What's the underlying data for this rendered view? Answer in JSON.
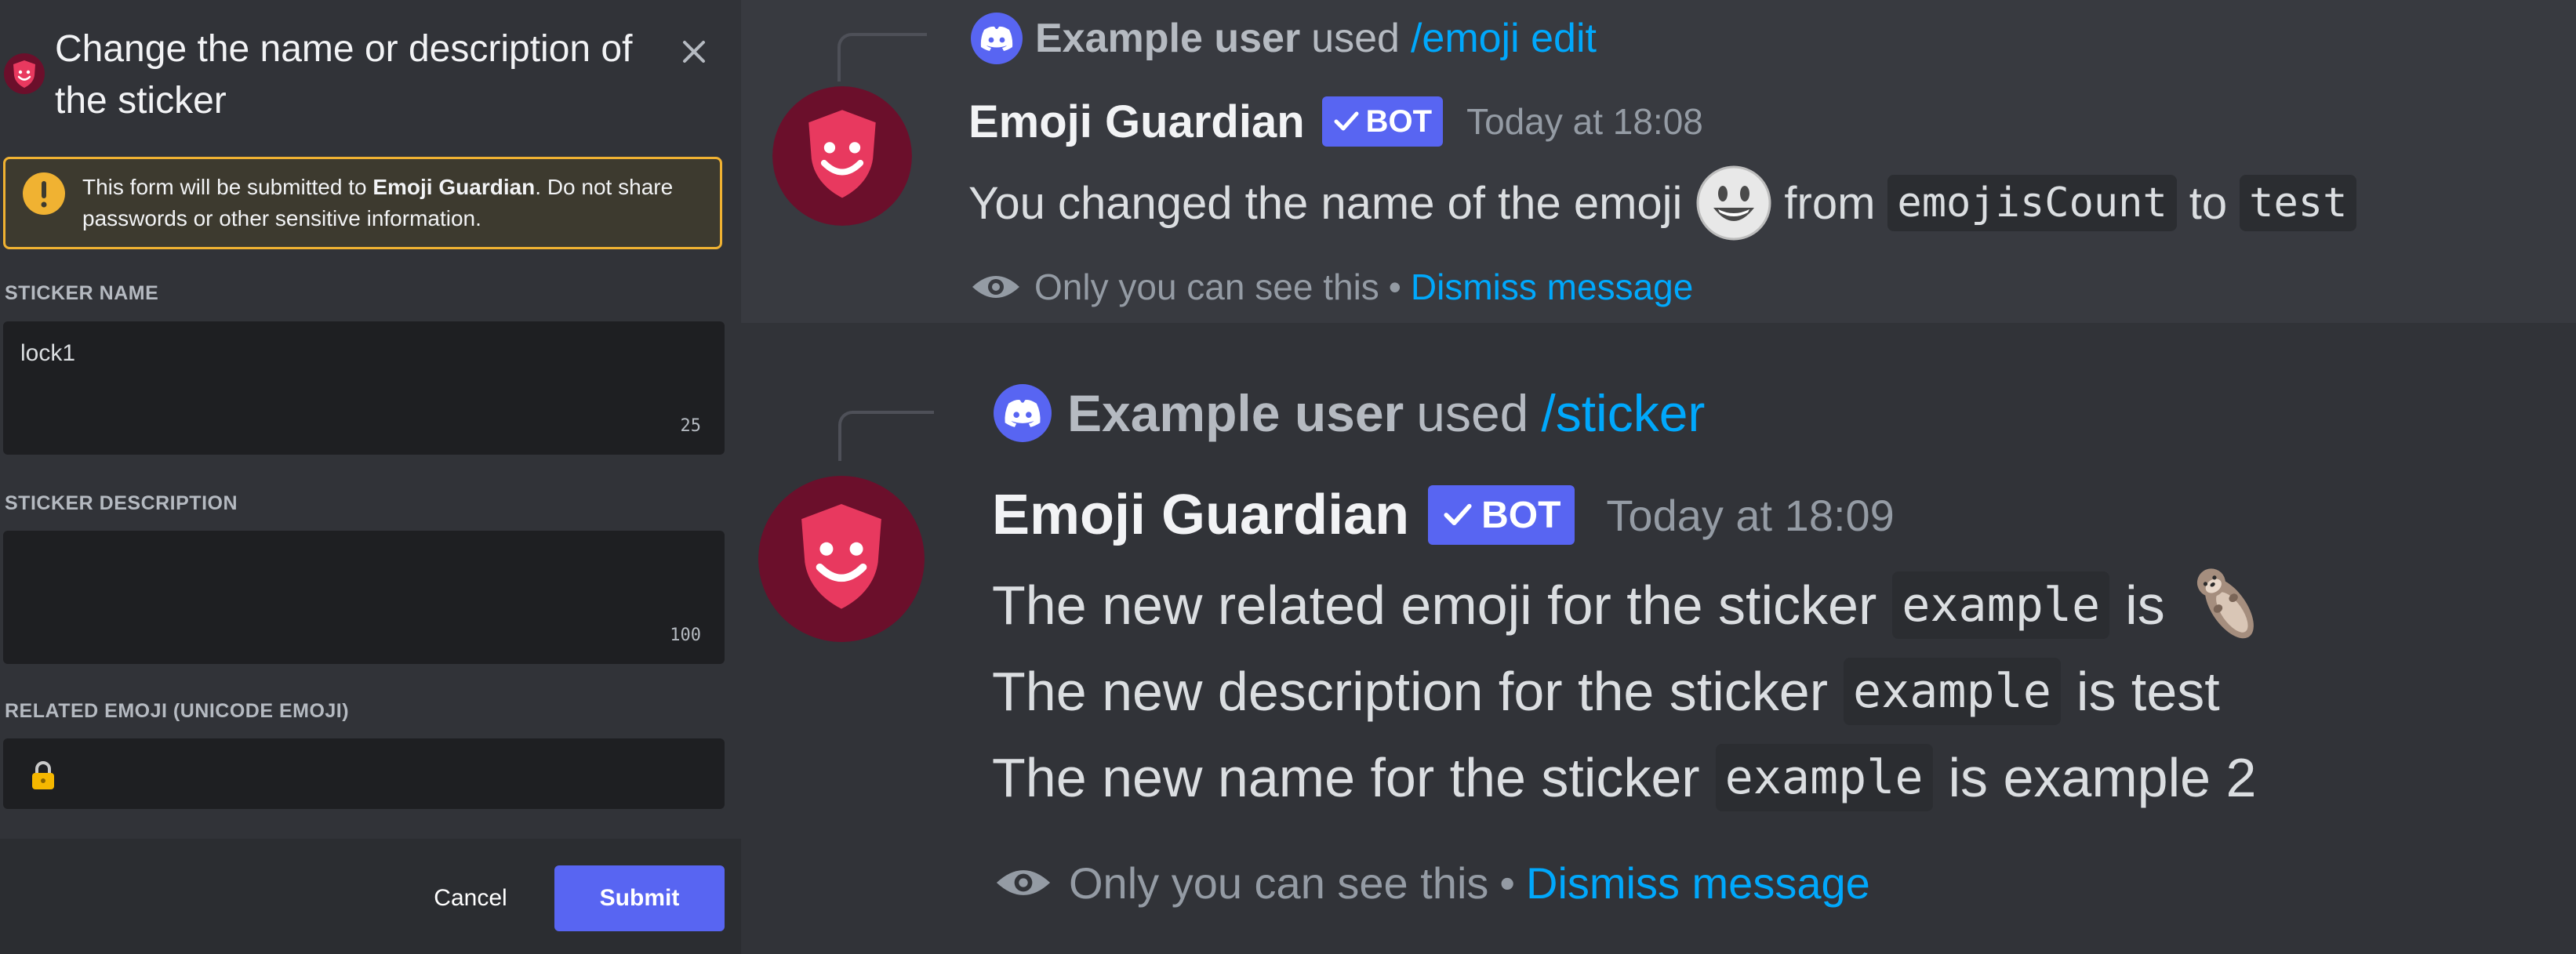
{
  "modal": {
    "title": "Change the name or description of the sticker",
    "warning": {
      "prefix": "This form will be submitted to ",
      "app_name": "Emoji Guardian",
      "suffix": ". Do not share passwords or other sensitive information."
    },
    "fields": {
      "sticker_name": {
        "label": "STICKER NAME",
        "value": "lock1",
        "max_length": "25"
      },
      "sticker_description": {
        "label": "STICKER DESCRIPTION",
        "value": "",
        "max_length": "100"
      },
      "related_emoji": {
        "label": "RELATED EMOJI (UNICODE EMOJI)",
        "value": "🔒"
      }
    },
    "cancel_label": "Cancel",
    "submit_label": "Submit"
  },
  "messages": [
    {
      "reply_user": "Example user",
      "reply_used": "used",
      "reply_command": "/emoji edit",
      "author": "Emoji Guardian",
      "bot_tag": "BOT",
      "timestamp": "Today at 18:08",
      "lines": [
        {
          "part1": "You changed the name of the emoji",
          "part2": "from",
          "code1": "emojisCount",
          "part3": "to",
          "code2": "test"
        }
      ],
      "only_you": "Only you can see this",
      "separator": "•",
      "dismiss": "Dismiss message"
    },
    {
      "reply_user": "Example user",
      "reply_used": "used",
      "reply_command": "/sticker",
      "author": "Emoji Guardian",
      "bot_tag": "BOT",
      "timestamp": "Today at 18:09",
      "lines": [
        {
          "before": "The new related emoji for the sticker",
          "code": "example",
          "after": "is"
        },
        {
          "before": "The new description for the sticker",
          "code": "example",
          "after": "is test"
        },
        {
          "before": "The new name for the sticker",
          "code": "example",
          "after": "is example 2"
        }
      ],
      "only_you": "Only you can see this",
      "separator": "•",
      "dismiss": "Dismiss message"
    }
  ],
  "colors": {
    "blurple": "#5865f2",
    "link": "#00a8fc",
    "warning_border": "#f0b232",
    "avatar_dark": "#6b0f2b",
    "avatar_shield": "#e8395f"
  },
  "icons": {
    "close": "close-icon",
    "warning": "exclamation-icon",
    "lock": "lock-icon",
    "eye": "eye-icon",
    "discord": "discord-icon",
    "check": "check-icon"
  }
}
